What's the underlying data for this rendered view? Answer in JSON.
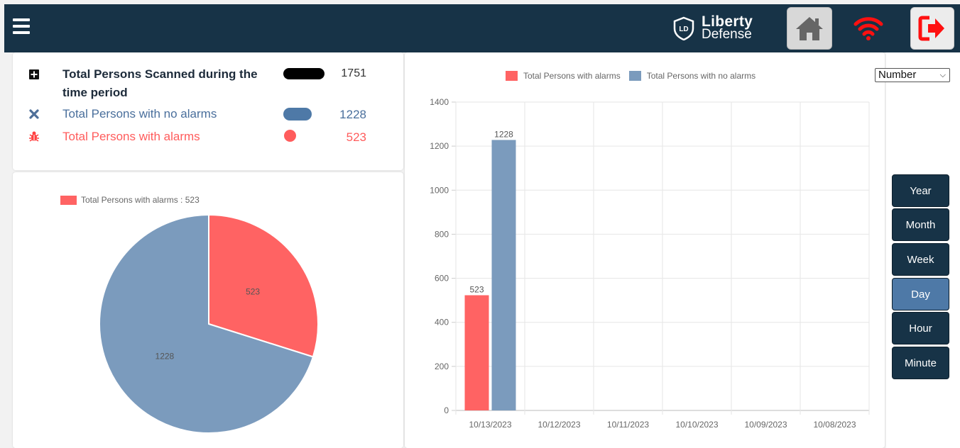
{
  "header": {
    "logo_line1": "Liberty",
    "logo_line2": "Defense",
    "logo_mark": "LD"
  },
  "summary": {
    "rows": [
      {
        "label": "Total Persons Scanned during the time period",
        "value": "1751",
        "color": "#000000"
      },
      {
        "label": "Total Persons with no alarms",
        "value": "1228",
        "color": "#4e79a7"
      },
      {
        "label": "Total Persons with alarms",
        "value": "523",
        "color": "#ff5c5c"
      }
    ]
  },
  "pie": {
    "legend": "Total Persons with alarms : 523",
    "slice_alarms_label": "523",
    "slice_no_alarms_label": "1228"
  },
  "select": {
    "value": "Number"
  },
  "time_buttons": [
    "Year",
    "Month",
    "Week",
    "Day",
    "Hour",
    "Minute"
  ],
  "active_time_button": "Day",
  "colors": {
    "alarms": "#ff6363",
    "no_alarms": "#7b9bbd",
    "navy": "#173347"
  },
  "chart_data": [
    {
      "type": "pie",
      "categories": [
        "Total Persons with alarms",
        "Total Persons with no alarms"
      ],
      "values": [
        523,
        1228
      ],
      "legend_position": "top-left"
    },
    {
      "type": "bar",
      "categories": [
        "10/13/2023",
        "10/12/2023",
        "10/11/2023",
        "10/10/2023",
        "10/09/2023",
        "10/08/2023"
      ],
      "series": [
        {
          "name": "Total Persons with alarms",
          "values": [
            523,
            0,
            0,
            0,
            0,
            0
          ]
        },
        {
          "name": "Total Persons with no alarms",
          "values": [
            1228,
            0,
            0,
            0,
            0,
            0
          ]
        }
      ],
      "ylim": [
        0,
        1400
      ],
      "yticks": [
        0,
        200,
        400,
        600,
        800,
        1000,
        1200,
        1400
      ],
      "grid": true,
      "legend_position": "top"
    }
  ]
}
